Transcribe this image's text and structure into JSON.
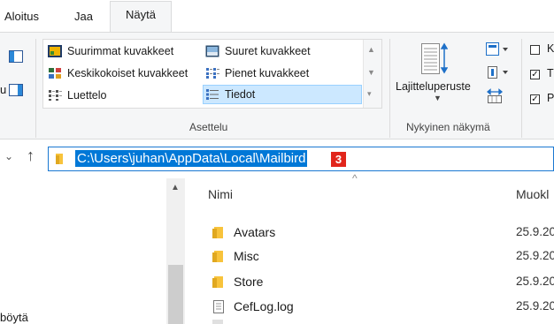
{
  "tabs": {
    "home": "Aloitus",
    "share": "Jaa",
    "view": "Näytä"
  },
  "layout_options": [
    {
      "label": "Suurimmat kuvakkeet",
      "icon": "extra-large-icons-icon"
    },
    {
      "label": "Keskikokoiset kuvakkeet",
      "icon": "medium-icons-icon"
    },
    {
      "label": "Luettelo",
      "icon": "list-view-icon"
    },
    {
      "label": "Suuret kuvakkeet",
      "icon": "large-icons-icon"
    },
    {
      "label": "Pienet kuvakkeet",
      "icon": "small-icons-icon"
    },
    {
      "label": "Tiedot",
      "icon": "details-view-icon"
    }
  ],
  "layout_selected": "Tiedot",
  "group_layout_label": "Asettelu",
  "sort_by_label": "Lajitteluperuste",
  "group_current_view_label": "Nykyinen näkymä",
  "checkbox_truncated": [
    {
      "text": "K",
      "checked": false
    },
    {
      "text": "T",
      "checked": true
    },
    {
      "text": "P",
      "checked": true
    }
  ],
  "address": {
    "path": "C:\\Users\\juhan\\AppData\\Local\\Mailbird",
    "marker": "3"
  },
  "columns": {
    "name": "Nimi",
    "modified": "Muokl"
  },
  "nav_partial_label": "böytä",
  "files": [
    {
      "name": "Avatars",
      "date": "25.9.20",
      "type": "folder"
    },
    {
      "name": "Misc",
      "date": "25.9.20",
      "type": "folder"
    },
    {
      "name": "Store",
      "date": "25.9.20",
      "type": "folder"
    },
    {
      "name": "CefLog.log",
      "date": "25.9.20",
      "type": "file"
    }
  ],
  "colors": {
    "accent": "#0078d7",
    "selection": "#cce8ff",
    "folder": "#f8c33b",
    "marker": "#e1251b"
  }
}
